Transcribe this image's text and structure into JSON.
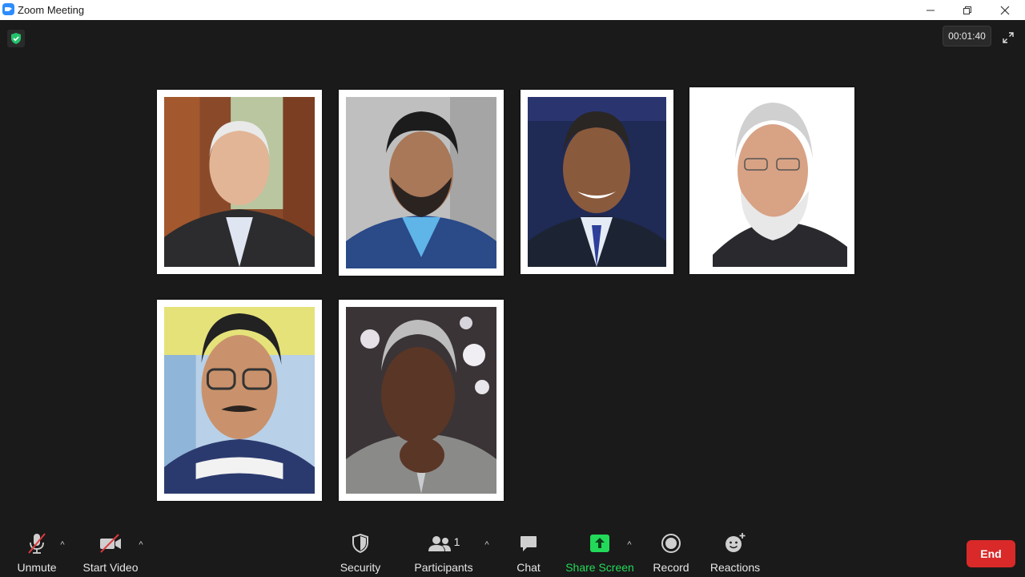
{
  "window": {
    "title": "Zoom Meeting",
    "minimize_icon": "minimize-icon",
    "restore_icon": "restore-icon",
    "close_icon": "close-icon"
  },
  "meeting": {
    "security_status_icon": "shield-check-icon",
    "elapsed_time": "00:01:40",
    "fullscreen_icon": "expand-icon"
  },
  "participants_grid": [
    {
      "tile": "video-tile-1",
      "content": "participant photo"
    },
    {
      "tile": "video-tile-2",
      "content": "participant photo"
    },
    {
      "tile": "video-tile-3",
      "content": "participant photo"
    },
    {
      "tile": "video-tile-4",
      "content": "participant photo"
    },
    {
      "tile": "video-tile-5",
      "content": "participant photo"
    },
    {
      "tile": "video-tile-6",
      "content": "participant photo"
    }
  ],
  "toolbar": {
    "unmute_label": "Unmute",
    "start_video_label": "Start Video",
    "security_label": "Security",
    "participants_label": "Participants",
    "participants_count": "1",
    "chat_label": "Chat",
    "share_screen_label": "Share Screen",
    "record_label": "Record",
    "reactions_label": "Reactions",
    "end_label": "End",
    "caret_glyph": "^"
  },
  "colors": {
    "background": "#1a1a1a",
    "share_screen_green": "#23d959",
    "end_red": "#d92929",
    "muted_slash_red": "#e0393e",
    "shield_green": "#23c16b"
  }
}
